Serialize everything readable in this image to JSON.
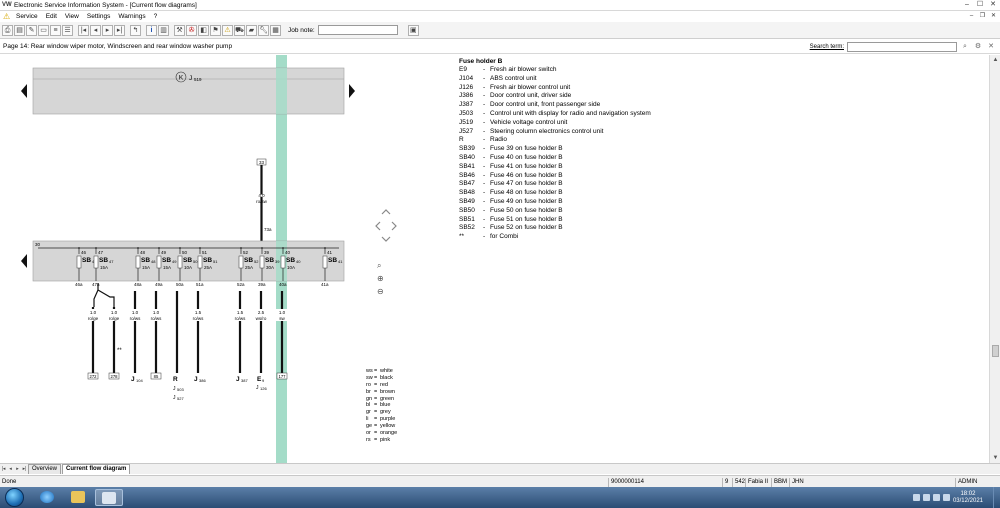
{
  "window": {
    "title": "Electronic Service Information System - [Current flow diagrams]",
    "logo": "VW"
  },
  "menu": {
    "items": [
      "Service",
      "Edit",
      "View",
      "Settings",
      "Warnings",
      "?"
    ]
  },
  "toolbar": {
    "job_note_label": "Job note:",
    "job_note_value": ""
  },
  "page": {
    "title": "Page 14: Rear window wiper motor, Windscreen and rear window washer pump",
    "search_label": "Search term:",
    "search_value": ""
  },
  "diagram": {
    "top_component": {
      "symbol": "K",
      "label": "J",
      "sub": "519"
    },
    "top_wire": {
      "terminal": "33",
      "gauge": "4.0",
      "color": "ro/sw",
      "bottom_label": "73a"
    },
    "fuse_holder_terminal": "30",
    "fuses": [
      {
        "pin": "46",
        "name": "SB",
        "num": "46",
        "amp": "",
        "out": "46a"
      },
      {
        "pin": "47",
        "name": "SB",
        "num": "47",
        "amp": "15A",
        "out": "47a"
      },
      {
        "pin": "48",
        "name": "SB",
        "num": "48",
        "amp": "15A",
        "out": "48a"
      },
      {
        "pin": "49",
        "name": "SB",
        "num": "49",
        "amp": "15A",
        "out": "49a"
      },
      {
        "pin": "50",
        "name": "SB",
        "num": "50",
        "amp": "10A",
        "out": "50a"
      },
      {
        "pin": "51",
        "name": "SB",
        "num": "51",
        "amp": "25A",
        "out": "51a"
      },
      {
        "pin": "52",
        "name": "SB",
        "num": "52",
        "amp": "25A",
        "out": "52a"
      },
      {
        "pin": "39",
        "name": "SB",
        "num": "39",
        "amp": "30A",
        "out": "39a"
      },
      {
        "pin": "40",
        "name": "SB",
        "num": "40",
        "amp": "10A",
        "out": "40a"
      },
      {
        "pin": "41",
        "name": "SB",
        "num": "41",
        "amp": "",
        "out": "41a"
      }
    ],
    "wires": [
      {
        "gauge": "1.0",
        "color": "ro/ge",
        "end": "272"
      },
      {
        "gauge": "1.0",
        "color": "ro/ge",
        "end": "278"
      },
      {
        "gauge": "1.0",
        "color": "ro/ws",
        "end": "J",
        "end_sub": "104"
      },
      {
        "gauge": "1.0",
        "color": "ro/ws",
        "end": "85"
      },
      {
        "gauge": "",
        "color": "",
        "end": "R"
      },
      {
        "gauge": "1.5",
        "color": "ro/ws",
        "end": "J",
        "end_sub": "386"
      },
      {
        "gauge": "1.5",
        "color": "ro/ws",
        "end": "J",
        "end_sub": "387"
      },
      {
        "gauge": "2.5",
        "color": "ws/ro",
        "end": "E",
        "end_sub": "9"
      },
      {
        "gauge": "1.0",
        "color": "sw",
        "end": "177"
      }
    ],
    "extra_labels": {
      "star": "**",
      "r_sub1": "J",
      "r_sub1n": "503",
      "r_sub2": "J",
      "r_sub2n": "527",
      "e9_sub": "J",
      "e9_subn": "126"
    }
  },
  "legend": {
    "title": "Fuse holder B",
    "items": [
      {
        "code": "E9",
        "desc": "Fresh air blower switch"
      },
      {
        "code": "J104",
        "desc": "ABS control unit"
      },
      {
        "code": "J126",
        "desc": "Fresh air blower control unit"
      },
      {
        "code": "J386",
        "desc": "Door control unit, driver side"
      },
      {
        "code": "J387",
        "desc": "Door control unit, front passenger side"
      },
      {
        "code": "J503",
        "desc": "Control unit with display for radio and navigation system"
      },
      {
        "code": "J519",
        "desc": "Vehicle voltage control unit"
      },
      {
        "code": "J527",
        "desc": "Steering column electronics control unit"
      },
      {
        "code": "R",
        "desc": "Radio"
      },
      {
        "code": "SB39",
        "desc": "Fuse 39 on fuse holder B"
      },
      {
        "code": "SB40",
        "desc": "Fuse 40 on fuse holder B"
      },
      {
        "code": "SB41",
        "desc": "Fuse 41 on fuse holder B"
      },
      {
        "code": "SB46",
        "desc": "Fuse 46 on fuse holder B"
      },
      {
        "code": "SB47",
        "desc": "Fuse 47 on fuse holder B"
      },
      {
        "code": "SB48",
        "desc": "Fuse 48 on fuse holder B"
      },
      {
        "code": "SB49",
        "desc": "Fuse 49 on fuse holder B"
      },
      {
        "code": "SB50",
        "desc": "Fuse 50 on fuse holder B"
      },
      {
        "code": "SB51",
        "desc": "Fuse 51 on fuse holder B"
      },
      {
        "code": "SB52",
        "desc": "Fuse 52 on fuse holder B"
      },
      {
        "code": "**",
        "desc": "for Combi"
      }
    ]
  },
  "color_codes": [
    {
      "code": "ws",
      "name": "white"
    },
    {
      "code": "sw",
      "name": "black"
    },
    {
      "code": "ro",
      "name": "red"
    },
    {
      "code": "br",
      "name": "brown"
    },
    {
      "code": "gn",
      "name": "green"
    },
    {
      "code": "bl",
      "name": "blue"
    },
    {
      "code": "gr",
      "name": "grey"
    },
    {
      "code": "li",
      "name": "purple"
    },
    {
      "code": "ge",
      "name": "yellow"
    },
    {
      "code": "or",
      "name": "orange"
    },
    {
      "code": "rs",
      "name": "pink"
    }
  ],
  "tabs": [
    {
      "label": "Overview",
      "active": false
    },
    {
      "label": "Current flow diagram",
      "active": true
    }
  ],
  "status": {
    "left": "Done",
    "code": "9000000114",
    "n1": "9",
    "n2": "542",
    "model": "Fabia II",
    "c1": "BBM",
    "c2": "JHN",
    "user": "ADMIN"
  },
  "taskbar": {
    "time": "18:02",
    "date": "03/12/2021"
  },
  "colors": {
    "highlight": "#9fd9c5",
    "panel": "#d8d8d8"
  }
}
